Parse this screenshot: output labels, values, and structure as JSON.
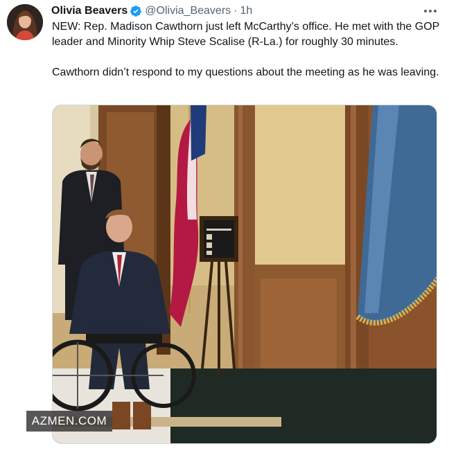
{
  "tweet": {
    "author_name": "Olivia Beavers",
    "handle": "@Olivia_Beavers",
    "separator": "·",
    "time": "1h",
    "verified_color": "#1d9bf0",
    "paragraphs": [
      "NEW: Rep. Madison Cawthorn just left McCarthy’s office. He met with the GOP leader and Minority Whip Steve Scalise (R-La.) for roughly 30 minutes.",
      "Cawthorn didn’t respond to my questions about the meeting as he was leaving."
    ],
    "watermark": "AZMEN.COM"
  },
  "icons": {
    "verified": "verified-badge-icon",
    "more": "more-options-icon"
  }
}
